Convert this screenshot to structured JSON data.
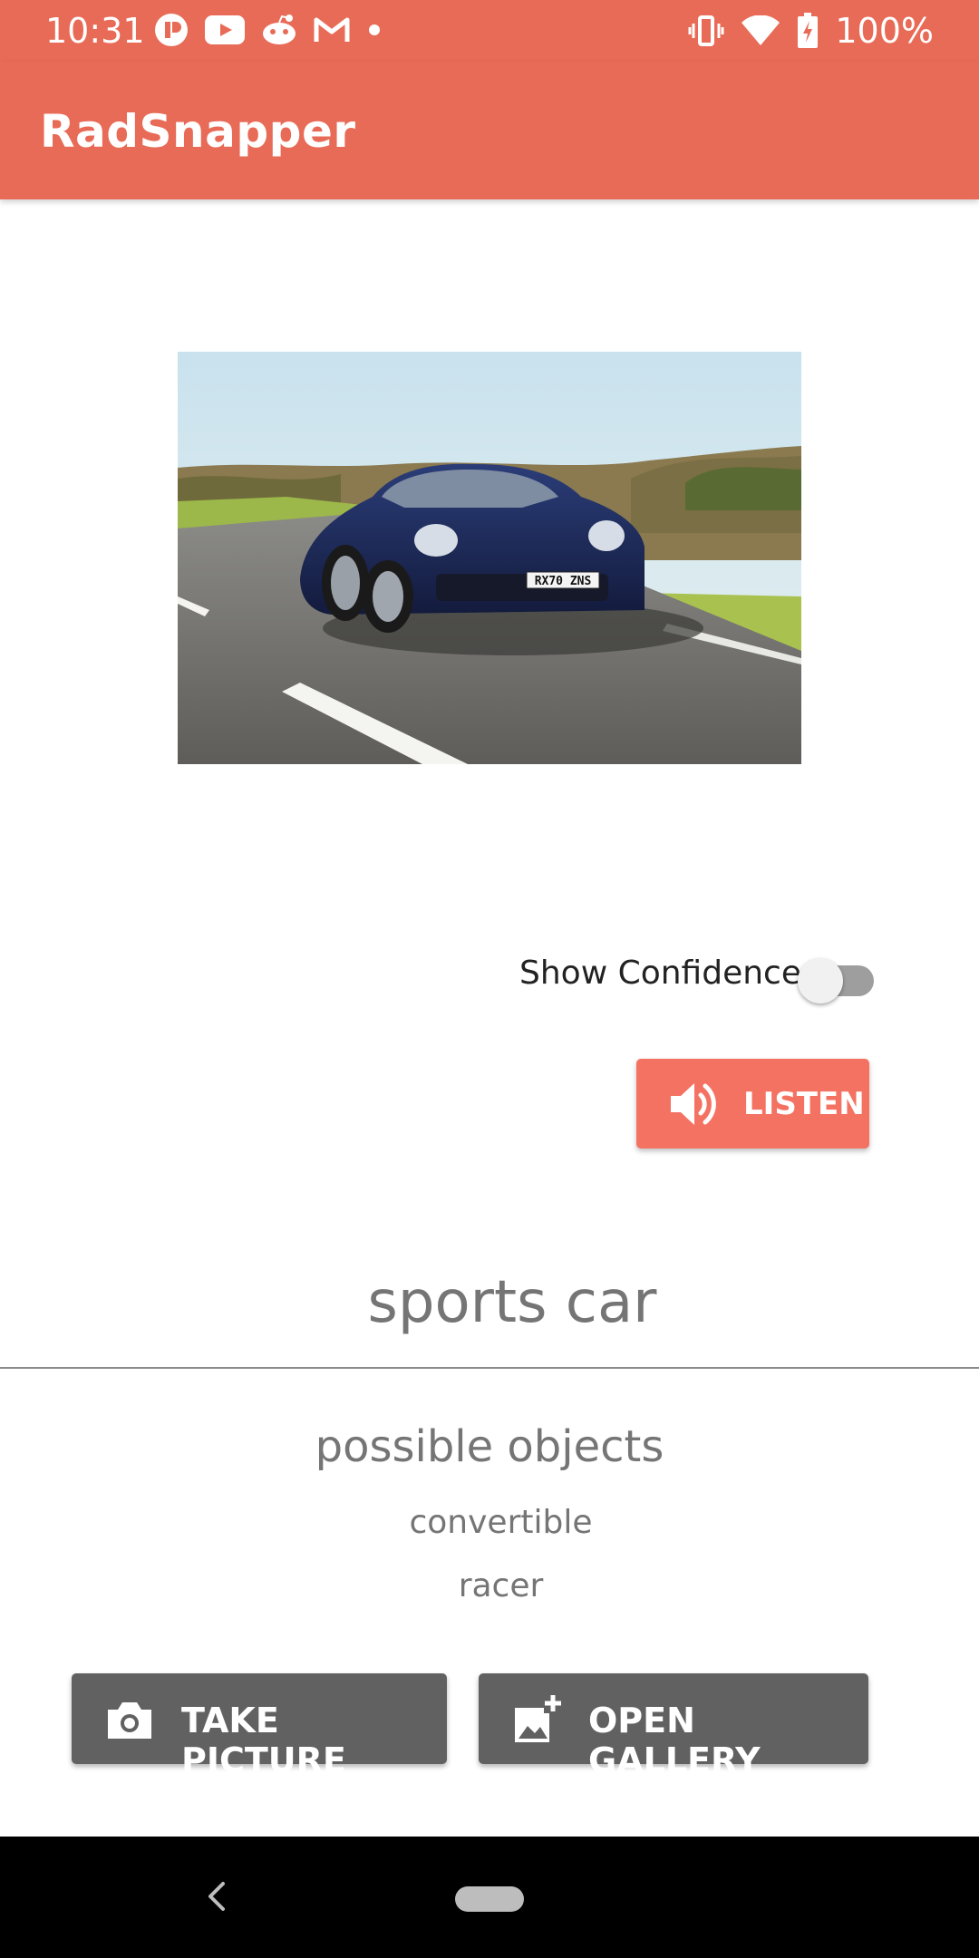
{
  "status_bar": {
    "time": "10:31",
    "battery_text": "100%",
    "left_icons": [
      "app-icon",
      "youtube-icon",
      "reddit-icon",
      "gmail-icon",
      "dot-icon"
    ],
    "right_icons": [
      "vibrate-icon",
      "wifi-icon",
      "battery-icon"
    ]
  },
  "app_bar": {
    "title": "RadSnapper"
  },
  "photo": {
    "plate_text": "RX70 ZNS"
  },
  "confidence": {
    "label": "Show Confidence",
    "enabled": false
  },
  "listen_button": {
    "label": "LISTEN",
    "icon": "speaker-icon"
  },
  "result": {
    "label": "sports car"
  },
  "possible": {
    "title": "possible objects",
    "items": [
      "convertible",
      "racer"
    ]
  },
  "actions": {
    "take_picture": "TAKE PICTURE",
    "open_gallery": "OPEN GALLERY"
  },
  "colors": {
    "app_bar": "#e86b57",
    "listen_button": "#f47262",
    "action_buttons": "#616161"
  }
}
